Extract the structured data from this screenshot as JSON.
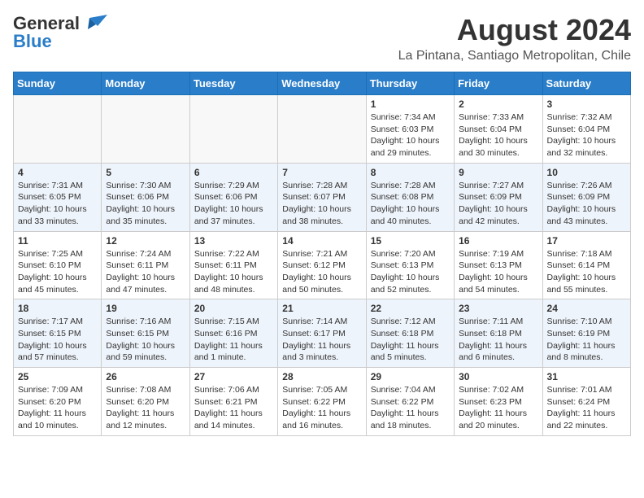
{
  "header": {
    "logo_general": "General",
    "logo_blue": "Blue",
    "month_year": "August 2024",
    "location": "La Pintana, Santiago Metropolitan, Chile"
  },
  "calendar": {
    "days_of_week": [
      "Sunday",
      "Monday",
      "Tuesday",
      "Wednesday",
      "Thursday",
      "Friday",
      "Saturday"
    ],
    "weeks": [
      [
        {
          "day": "",
          "info": ""
        },
        {
          "day": "",
          "info": ""
        },
        {
          "day": "",
          "info": ""
        },
        {
          "day": "",
          "info": ""
        },
        {
          "day": "1",
          "info": "Sunrise: 7:34 AM\nSunset: 6:03 PM\nDaylight: 10 hours\nand 29 minutes."
        },
        {
          "day": "2",
          "info": "Sunrise: 7:33 AM\nSunset: 6:04 PM\nDaylight: 10 hours\nand 30 minutes."
        },
        {
          "day": "3",
          "info": "Sunrise: 7:32 AM\nSunset: 6:04 PM\nDaylight: 10 hours\nand 32 minutes."
        }
      ],
      [
        {
          "day": "4",
          "info": "Sunrise: 7:31 AM\nSunset: 6:05 PM\nDaylight: 10 hours\nand 33 minutes."
        },
        {
          "day": "5",
          "info": "Sunrise: 7:30 AM\nSunset: 6:06 PM\nDaylight: 10 hours\nand 35 minutes."
        },
        {
          "day": "6",
          "info": "Sunrise: 7:29 AM\nSunset: 6:06 PM\nDaylight: 10 hours\nand 37 minutes."
        },
        {
          "day": "7",
          "info": "Sunrise: 7:28 AM\nSunset: 6:07 PM\nDaylight: 10 hours\nand 38 minutes."
        },
        {
          "day": "8",
          "info": "Sunrise: 7:28 AM\nSunset: 6:08 PM\nDaylight: 10 hours\nand 40 minutes."
        },
        {
          "day": "9",
          "info": "Sunrise: 7:27 AM\nSunset: 6:09 PM\nDaylight: 10 hours\nand 42 minutes."
        },
        {
          "day": "10",
          "info": "Sunrise: 7:26 AM\nSunset: 6:09 PM\nDaylight: 10 hours\nand 43 minutes."
        }
      ],
      [
        {
          "day": "11",
          "info": "Sunrise: 7:25 AM\nSunset: 6:10 PM\nDaylight: 10 hours\nand 45 minutes."
        },
        {
          "day": "12",
          "info": "Sunrise: 7:24 AM\nSunset: 6:11 PM\nDaylight: 10 hours\nand 47 minutes."
        },
        {
          "day": "13",
          "info": "Sunrise: 7:22 AM\nSunset: 6:11 PM\nDaylight: 10 hours\nand 48 minutes."
        },
        {
          "day": "14",
          "info": "Sunrise: 7:21 AM\nSunset: 6:12 PM\nDaylight: 10 hours\nand 50 minutes."
        },
        {
          "day": "15",
          "info": "Sunrise: 7:20 AM\nSunset: 6:13 PM\nDaylight: 10 hours\nand 52 minutes."
        },
        {
          "day": "16",
          "info": "Sunrise: 7:19 AM\nSunset: 6:13 PM\nDaylight: 10 hours\nand 54 minutes."
        },
        {
          "day": "17",
          "info": "Sunrise: 7:18 AM\nSunset: 6:14 PM\nDaylight: 10 hours\nand 55 minutes."
        }
      ],
      [
        {
          "day": "18",
          "info": "Sunrise: 7:17 AM\nSunset: 6:15 PM\nDaylight: 10 hours\nand 57 minutes."
        },
        {
          "day": "19",
          "info": "Sunrise: 7:16 AM\nSunset: 6:15 PM\nDaylight: 10 hours\nand 59 minutes."
        },
        {
          "day": "20",
          "info": "Sunrise: 7:15 AM\nSunset: 6:16 PM\nDaylight: 11 hours\nand 1 minute."
        },
        {
          "day": "21",
          "info": "Sunrise: 7:14 AM\nSunset: 6:17 PM\nDaylight: 11 hours\nand 3 minutes."
        },
        {
          "day": "22",
          "info": "Sunrise: 7:12 AM\nSunset: 6:18 PM\nDaylight: 11 hours\nand 5 minutes."
        },
        {
          "day": "23",
          "info": "Sunrise: 7:11 AM\nSunset: 6:18 PM\nDaylight: 11 hours\nand 6 minutes."
        },
        {
          "day": "24",
          "info": "Sunrise: 7:10 AM\nSunset: 6:19 PM\nDaylight: 11 hours\nand 8 minutes."
        }
      ],
      [
        {
          "day": "25",
          "info": "Sunrise: 7:09 AM\nSunset: 6:20 PM\nDaylight: 11 hours\nand 10 minutes."
        },
        {
          "day": "26",
          "info": "Sunrise: 7:08 AM\nSunset: 6:20 PM\nDaylight: 11 hours\nand 12 minutes."
        },
        {
          "day": "27",
          "info": "Sunrise: 7:06 AM\nSunset: 6:21 PM\nDaylight: 11 hours\nand 14 minutes."
        },
        {
          "day": "28",
          "info": "Sunrise: 7:05 AM\nSunset: 6:22 PM\nDaylight: 11 hours\nand 16 minutes."
        },
        {
          "day": "29",
          "info": "Sunrise: 7:04 AM\nSunset: 6:22 PM\nDaylight: 11 hours\nand 18 minutes."
        },
        {
          "day": "30",
          "info": "Sunrise: 7:02 AM\nSunset: 6:23 PM\nDaylight: 11 hours\nand 20 minutes."
        },
        {
          "day": "31",
          "info": "Sunrise: 7:01 AM\nSunset: 6:24 PM\nDaylight: 11 hours\nand 22 minutes."
        }
      ]
    ]
  }
}
